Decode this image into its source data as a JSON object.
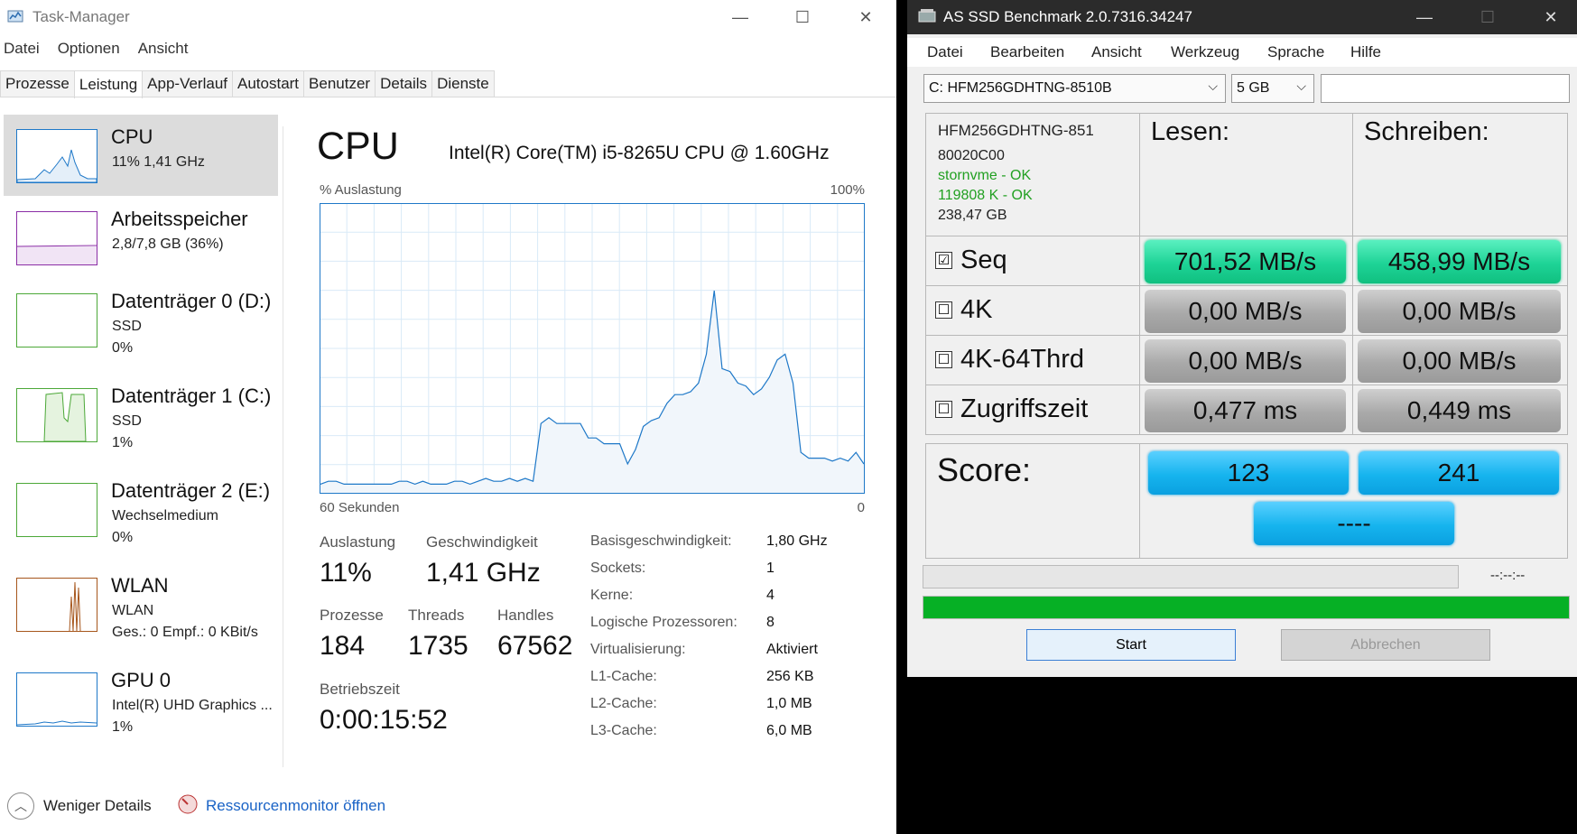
{
  "taskmanager": {
    "title": "Task-Manager",
    "menu": [
      "Datei",
      "Optionen",
      "Ansicht"
    ],
    "tabs": [
      "Prozesse",
      "Leistung",
      "App-Verlauf",
      "Autostart",
      "Benutzer",
      "Details",
      "Dienste"
    ],
    "active_tab": "Leistung",
    "sidebar": [
      {
        "name": "CPU",
        "line1": "11%  1,41 GHz",
        "line2": "",
        "color": "#1e78c8"
      },
      {
        "name": "Arbeitsspeicher",
        "line1": "2,8/7,8 GB (36%)",
        "line2": "",
        "color": "#8b2ea6"
      },
      {
        "name": "Datenträger 0 (D:)",
        "line1": "SSD",
        "line2": "0%",
        "color": "#4ca838"
      },
      {
        "name": "Datenträger 1 (C:)",
        "line1": "SSD",
        "line2": "1%",
        "color": "#4ca838"
      },
      {
        "name": "Datenträger 2 (E:)",
        "line1": "Wechselmedium",
        "line2": "0%",
        "color": "#4ca838"
      },
      {
        "name": "WLAN",
        "line1": "WLAN",
        "line2": "Ges.: 0  Empf.: 0 KBit/s",
        "color": "#a6561c"
      },
      {
        "name": "GPU 0",
        "line1": "Intel(R) UHD Graphics ...",
        "line2": "1%",
        "color": "#1e78c8"
      }
    ],
    "detail": {
      "title": "CPU",
      "model": "Intel(R) Core(TM) i5-8265U CPU @ 1.60GHz",
      "y_label": "% Auslastung",
      "y_max_label": "100%",
      "x_left_label": "60 Sekunden",
      "x_right_label": "0",
      "stats": {
        "auslastung_label": "Auslastung",
        "auslastung": "11%",
        "geschwindigkeit_label": "Geschwindigkeit",
        "geschwindigkeit": "1,41 GHz",
        "prozesse_label": "Prozesse",
        "prozesse": "184",
        "threads_label": "Threads",
        "threads": "1735",
        "handles_label": "Handles",
        "handles": "67562",
        "betriebszeit_label": "Betriebszeit",
        "betriebszeit": "0:00:15:52"
      },
      "specs": [
        {
          "k": "Basisgeschwindigkeit:",
          "v": "1,80 GHz"
        },
        {
          "k": "Sockets:",
          "v": "1"
        },
        {
          "k": "Kerne:",
          "v": "4"
        },
        {
          "k": "Logische Prozessoren:",
          "v": "8"
        },
        {
          "k": "Virtualisierung:",
          "v": "Aktiviert"
        },
        {
          "k": "L1-Cache:",
          "v": "256 KB"
        },
        {
          "k": "L2-Cache:",
          "v": "1,0 MB"
        },
        {
          "k": "L3-Cache:",
          "v": "6,0 MB"
        }
      ]
    },
    "cpu_graph": [
      3,
      4,
      4,
      3,
      3,
      3,
      3,
      3,
      3,
      3,
      4,
      4,
      3,
      4,
      3,
      3,
      3,
      4,
      4,
      3,
      4,
      5,
      4,
      4,
      5,
      4,
      5,
      4,
      24,
      26,
      24,
      24,
      24,
      24,
      19,
      19,
      17,
      17,
      17,
      10,
      15,
      23,
      25,
      26,
      31,
      34,
      34,
      35,
      38,
      48,
      70,
      43,
      42,
      38,
      37,
      34,
      36,
      40,
      46,
      48,
      38,
      14,
      12,
      12,
      12,
      11,
      12,
      11,
      14,
      10
    ],
    "footer": {
      "fewer_details": "Weniger Details",
      "resource_monitor": "Ressourcenmonitor öffnen"
    }
  },
  "ssd": {
    "title": "AS SSD Benchmark 2.0.7316.34247",
    "menu": [
      "Datei",
      "Bearbeiten",
      "Ansicht",
      "Werkzeug",
      "Sprache",
      "Hilfe"
    ],
    "drive": "C: HFM256GDHTNG-8510B",
    "size": "5 GB",
    "info": {
      "model": "HFM256GDHTNG-851",
      "firmware": "80020C00",
      "driver": "stornvme - OK",
      "align": "119808 K - OK",
      "capacity": "238,47 GB"
    },
    "info_ok_color": "#22a022",
    "read_header": "Lesen:",
    "write_header": "Schreiben:",
    "rows": [
      {
        "label": "Seq",
        "checked": true,
        "read": "701,52 MB/s",
        "write": "458,99 MB/s"
      },
      {
        "label": "4K",
        "checked": false,
        "read": "0,00 MB/s",
        "write": "0,00 MB/s"
      },
      {
        "label": "4K-64Thrd",
        "checked": false,
        "read": "0,00 MB/s",
        "write": "0,00 MB/s"
      },
      {
        "label": "Zugriffszeit",
        "checked": false,
        "read": "0,477 ms",
        "write": "0,449 ms"
      }
    ],
    "score_label": "Score:",
    "score_read": "123",
    "score_write": "241",
    "score_total": "----",
    "time": "--:--:--",
    "progress_fraction": 1.0,
    "start": "Start",
    "cancel": "Abbrechen",
    "check_mark": "☑",
    "uncheck_mark": "☐"
  }
}
